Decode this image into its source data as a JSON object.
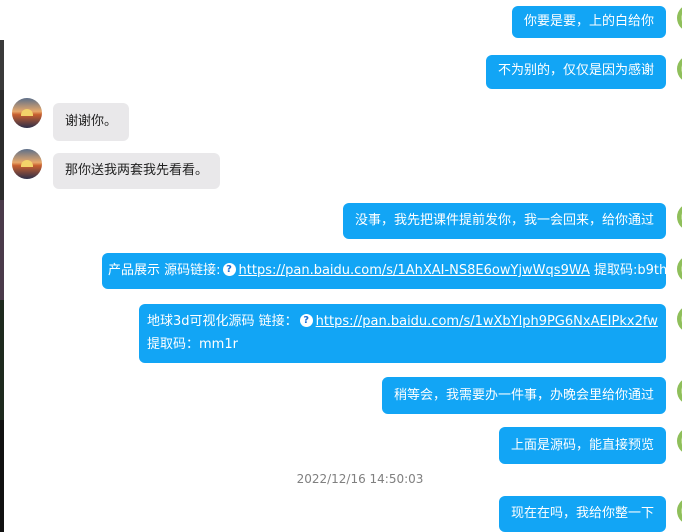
{
  "messages": [
    {
      "side": "out",
      "text": "你要是要，上的白给你"
    },
    {
      "side": "out",
      "text": "不为别的，仅仅是因为感谢"
    },
    {
      "side": "in",
      "text": "谢谢你。"
    },
    {
      "side": "in",
      "text": "那你送我两套我先看看。"
    },
    {
      "side": "out",
      "text": "没事，我先把课件提前发你，我一会回来，给你通过"
    },
    {
      "side": "out",
      "prefix": "产品展示 源码链接:",
      "link": "https://pan.baidu.com/s/1AhXAI-NS8E6owYjwWqs9WA",
      "suffix": " 提取码:b9th"
    },
    {
      "side": "out",
      "prefix": "地球3d可视化源码    链接：",
      "link": "https://pan.baidu.com/s/1wXbYlph9PG6NxAEIPkx2fw",
      "line2": "提取码：mm1r"
    },
    {
      "side": "out",
      "text": "稍等会，我需要办一件事，办晚会里给你通过"
    },
    {
      "side": "out",
      "text": "上面是源码，能直接预览"
    },
    {
      "side": "out",
      "text": "现在在吗，我给你整一下"
    }
  ],
  "timestamp": "2022/12/16 14:50:03",
  "icons": {
    "link_help": "question-circle-icon",
    "avatar": "sunset-avatar"
  },
  "colors": {
    "outgoing_bubble": "#12a5f5",
    "incoming_bubble": "#e9e8ea",
    "timestamp": "#808080"
  }
}
